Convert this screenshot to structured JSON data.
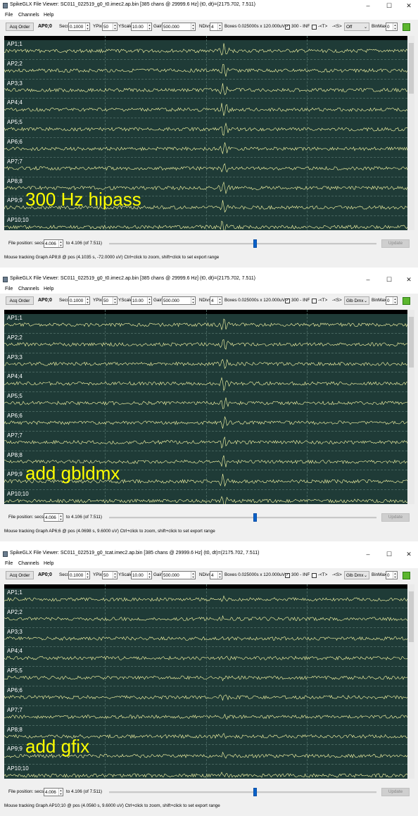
{
  "windows": [
    {
      "title": "SpikeGLX File Viewer: SC011_022519_g0_t0.imec2.ap.bin [385 chans @ 29999.6 Hz] (t0, dt)=(2175.702, 7.511)",
      "menu": [
        "File",
        "Channels",
        "Help"
      ],
      "toolbar": {
        "acq_order": "Acq Order",
        "graph": "AP0;0",
        "secs_label": "Secs",
        "secs_value": "0.1000",
        "ypix_label": "YPix",
        "ypix_value": "50",
        "yscale_label": "YScale",
        "yscale_value": "10.00",
        "gain_label": "Gain",
        "gain_value": "500.000",
        "ndivs_label": "NDivs",
        "ndivs_value": "4",
        "boxes_text": "Boxes 0.025000s x 120.000uV",
        "hipass_text": "300 - INF",
        "hipass_checked": true,
        "t_text": "-<T>",
        "t_checked": false,
        "s_text": "-<S>",
        "dmx_value": "Off",
        "binmax_label": "BinMax",
        "binmax_value": "0"
      },
      "channels": [
        "AP1;1",
        "AP2;2",
        "AP3;3",
        "AP4;4",
        "AP5;5",
        "AP6;6",
        "AP7;7",
        "AP8;8",
        "AP9;9",
        "AP10;10"
      ],
      "overlay": "300 Hz hipass",
      "file_position_label": "File position: secs",
      "file_position_value": "4.006",
      "file_position_range": "to 4.106 (of 7.511)",
      "slider_fraction": 0.54,
      "update_label": "Update",
      "status": "Mouse tracking Graph AP8;8 @ pos (4.1035 s, -72.0000 uV)   Ctrl+click to zoom, shift+click to set export range"
    },
    {
      "title": "SpikeGLX File Viewer: SC011_022519_g0_t0.imec2.ap.bin [385 chans @ 29999.6 Hz] (t0, dt)=(2175.702, 7.511)",
      "menu": [
        "File",
        "Channels",
        "Help"
      ],
      "toolbar": {
        "acq_order": "Acq Order",
        "graph": "AP0;0",
        "secs_label": "Secs",
        "secs_value": "0.1000",
        "ypix_label": "YPix",
        "ypix_value": "50",
        "yscale_label": "YScale",
        "yscale_value": "10.00",
        "gain_label": "Gain",
        "gain_value": "500.000",
        "ndivs_label": "NDivs",
        "ndivs_value": "4",
        "boxes_text": "Boxes 0.025000s x 120.000uV",
        "hipass_text": "300 - INF",
        "hipass_checked": true,
        "t_text": "-<T>",
        "t_checked": false,
        "s_text": "-<S>",
        "dmx_value": "Glb Dmx",
        "binmax_label": "BinMax",
        "binmax_value": "0"
      },
      "channels": [
        "AP1;1",
        "AP2;2",
        "AP3;3",
        "AP4;4",
        "AP5;5",
        "AP6;6",
        "AP7;7",
        "AP8;8",
        "AP9;9",
        "AP10;10"
      ],
      "overlay": "add gbldmx",
      "file_position_label": "File position: secs",
      "file_position_value": "4.006",
      "file_position_range": "to 4.106 (of 7.511)",
      "slider_fraction": 0.54,
      "update_label": "Update",
      "status": "Mouse tracking Graph AP6;6 @ pos (4.0698 s, 9.6000 uV)   Ctrl+click to zoom, shift+click to set export range"
    },
    {
      "title": "SpikeGLX File Viewer: SC011_022519_g0_tcat.imec2.ap.bin [385 chans @ 29999.6 Hz] (t0, dt)=(2175.702, 7.511)",
      "menu": [
        "File",
        "Channels",
        "Help"
      ],
      "toolbar": {
        "acq_order": "Acq Order",
        "graph": "AP0;0",
        "secs_label": "Secs",
        "secs_value": "0.1000",
        "ypix_label": "YPix",
        "ypix_value": "50",
        "yscale_label": "YScale",
        "yscale_value": "10.00",
        "gain_label": "Gain",
        "gain_value": "500.000",
        "ndivs_label": "NDivs",
        "ndivs_value": "4",
        "boxes_text": "Boxes 0.025000s x 120.000uV",
        "hipass_text": "300 - INF",
        "hipass_checked": true,
        "t_text": "-<T>",
        "t_checked": false,
        "s_text": "-<S>",
        "dmx_value": "Glb Dmx",
        "binmax_label": "BinMax",
        "binmax_value": "0"
      },
      "channels": [
        "AP1;1",
        "AP2;2",
        "AP3;3",
        "AP4;4",
        "AP5;5",
        "AP6;6",
        "AP7;7",
        "AP8;8",
        "AP9;9",
        "AP10;10"
      ],
      "overlay": "add gfix",
      "file_position_label": "File position: secs",
      "file_position_value": "4.006",
      "file_position_range": "to 4.106 (of 7.511)",
      "slider_fraction": 0.54,
      "update_label": "Update",
      "status": "Mouse tracking Graph AP10;10 @ pos (4.0560 s, 9.6000 uV)   Ctrl+click to zoom, shift+click to set export range"
    }
  ],
  "colors": {
    "plot_background": "#1f3b37",
    "trace": "#ffffaa",
    "grid": "#46645e",
    "channel_label": "#ffffff",
    "overlay_text": "#ffff00",
    "slider_handle": "#0a62c9"
  },
  "icons": {
    "app": "spikeglx-app-icon",
    "minimize": "minimize-icon",
    "maximize": "maximize-icon",
    "close": "close-icon",
    "green_tool": "green-tool-icon"
  }
}
